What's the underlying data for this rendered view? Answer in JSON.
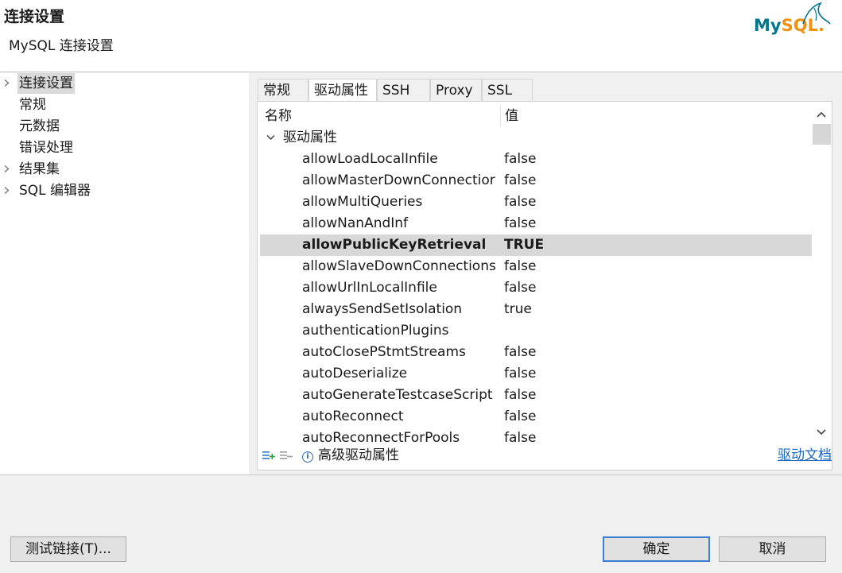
{
  "header": {
    "title": "连接设置",
    "subtitle": "MySQL 连接设置",
    "logo_text_my": "My",
    "logo_text_sql": "SQL",
    "logo_mark": "."
  },
  "nav": {
    "items": [
      {
        "label": "连接设置",
        "expandable": true,
        "selected": true
      },
      {
        "label": "常规",
        "expandable": false
      },
      {
        "label": "元数据",
        "expandable": false
      },
      {
        "label": "错误处理",
        "expandable": false
      },
      {
        "label": "结果集",
        "expandable": true
      },
      {
        "label": "SQL 编辑器",
        "expandable": true
      }
    ]
  },
  "tabs": [
    {
      "label": "常规"
    },
    {
      "label": "驱动属性",
      "active": true
    },
    {
      "label": "SSH"
    },
    {
      "label": "Proxy"
    },
    {
      "label": "SSL"
    }
  ],
  "table": {
    "col_name": "名称",
    "col_value": "值",
    "group_label": "驱动属性",
    "rows": [
      {
        "name": "allowLoadLocalInfile",
        "value": "false"
      },
      {
        "name": "allowMasterDownConnectior",
        "value": "false"
      },
      {
        "name": "allowMultiQueries",
        "value": "false"
      },
      {
        "name": "allowNanAndInf",
        "value": "false"
      },
      {
        "name": "allowPublicKeyRetrieval",
        "value": "TRUE",
        "highlight": true
      },
      {
        "name": "allowSlaveDownConnections",
        "value": "false"
      },
      {
        "name": "allowUrlInLocalInfile",
        "value": "false"
      },
      {
        "name": "alwaysSendSetIsolation",
        "value": "true"
      },
      {
        "name": "authenticationPlugins",
        "value": ""
      },
      {
        "name": "autoClosePStmtStreams",
        "value": "false"
      },
      {
        "name": "autoDeserialize",
        "value": "false"
      },
      {
        "name": "autoGenerateTestcaseScript",
        "value": "false"
      },
      {
        "name": "autoReconnect",
        "value": "false"
      },
      {
        "name": "autoReconnectForPools",
        "value": "false"
      }
    ]
  },
  "footer": {
    "advanced_label": "高级驱动属性",
    "doc_link": "驱动文档"
  },
  "buttons": {
    "test": "测试链接(T)...",
    "ok": "确定",
    "cancel": "取消"
  },
  "colors": {
    "logo_blue": "#00758f",
    "logo_orange": "#f29111",
    "link": "#1a66c2",
    "default_button_border": "#3c7fd1",
    "row_highlight": "#d8d8d8"
  }
}
